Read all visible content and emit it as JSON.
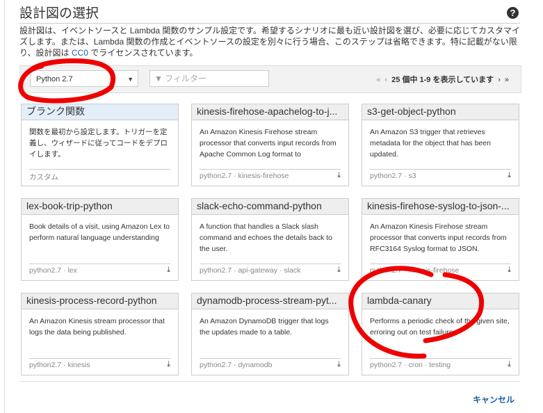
{
  "title": "設計図の選択",
  "help_icon": "?",
  "description": {
    "text": "設計図は、イベントソースと Lambda 関数のサンプル設定です。希望するシナリオに最も近い設計図を選び、必要に応じてカスタマイズします。または、Lambda 関数の作成とイベントソースの設定を別々に行う場合、このステップは省略できます。特に記載がない限り、設計図は ",
    "link": "CC0",
    "after": " でライセンスされています。"
  },
  "toolbar": {
    "runtime": "Python 2.7",
    "filter_placeholder": "フィルター",
    "first": "«",
    "prev": "‹",
    "pager_text": "25 個中 1-9 を表示しています",
    "next": "›",
    "last": "»"
  },
  "cards": [
    {
      "title": "ブランク関数",
      "desc": "関数を最初から設定します。トリガーを定義し、ウィザードに従ってコードをデプロイします。",
      "footer": "カスタム"
    },
    {
      "title": "kinesis-firehose-apachelog-to-j...",
      "desc": "An Amazon Kinesis Firehose stream processor that converts input records from Apache Common Log format to",
      "footer": "python2.7 · kinesis-firehose"
    },
    {
      "title": "s3-get-object-python",
      "desc": "An Amazon S3 trigger that retrieves metadata for the object that has been updated.",
      "footer": "python2.7 · s3"
    },
    {
      "title": "lex-book-trip-python",
      "desc": "Book details of a visit, using Amazon Lex to perform natural language understanding",
      "footer": "python2.7 · lex"
    },
    {
      "title": "slack-echo-command-python",
      "desc": "A function that handles a Slack slash command and echoes the details back to the user.",
      "footer": "python2.7 · api-gateway · slack"
    },
    {
      "title": "kinesis-firehose-syslog-to-json-...",
      "desc": "An Amazon Kinesis Firehose stream processor that converts input records from RFC3164 Syslog format to JSON.",
      "footer": "python2.7 · kinesis-firehose"
    },
    {
      "title": "kinesis-process-record-python",
      "desc": "An Amazon Kinesis stream processor that logs the data being published.",
      "footer": "python2.7 · kinesis"
    },
    {
      "title": "dynamodb-process-stream-pyt...",
      "desc": "An Amazon DynamoDB trigger that logs the updates made to a table.",
      "footer": "python2.7 · dynamodb"
    },
    {
      "title": "lambda-canary",
      "desc": "Performs a periodic check of the given site, erroring out on test failure.",
      "footer": "python2.7 · cron · testing"
    }
  ],
  "cancel": "キャンセル"
}
